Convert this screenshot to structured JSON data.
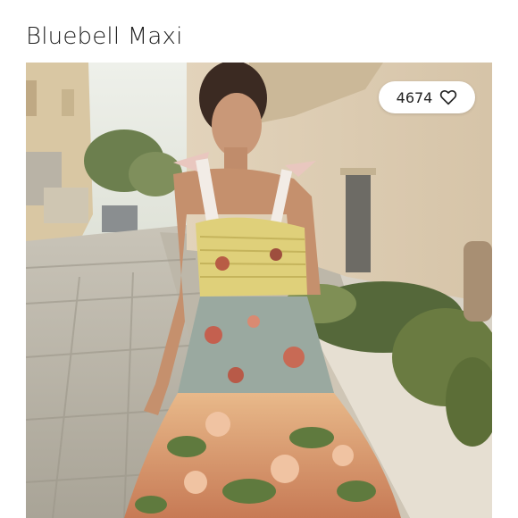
{
  "listing": {
    "title": "Bluebell Maxi",
    "likes": "4674"
  },
  "icons": {
    "like": "heart-outline-icon"
  },
  "colors": {
    "text": "#222222",
    "pill_bg": "#ffffff"
  }
}
